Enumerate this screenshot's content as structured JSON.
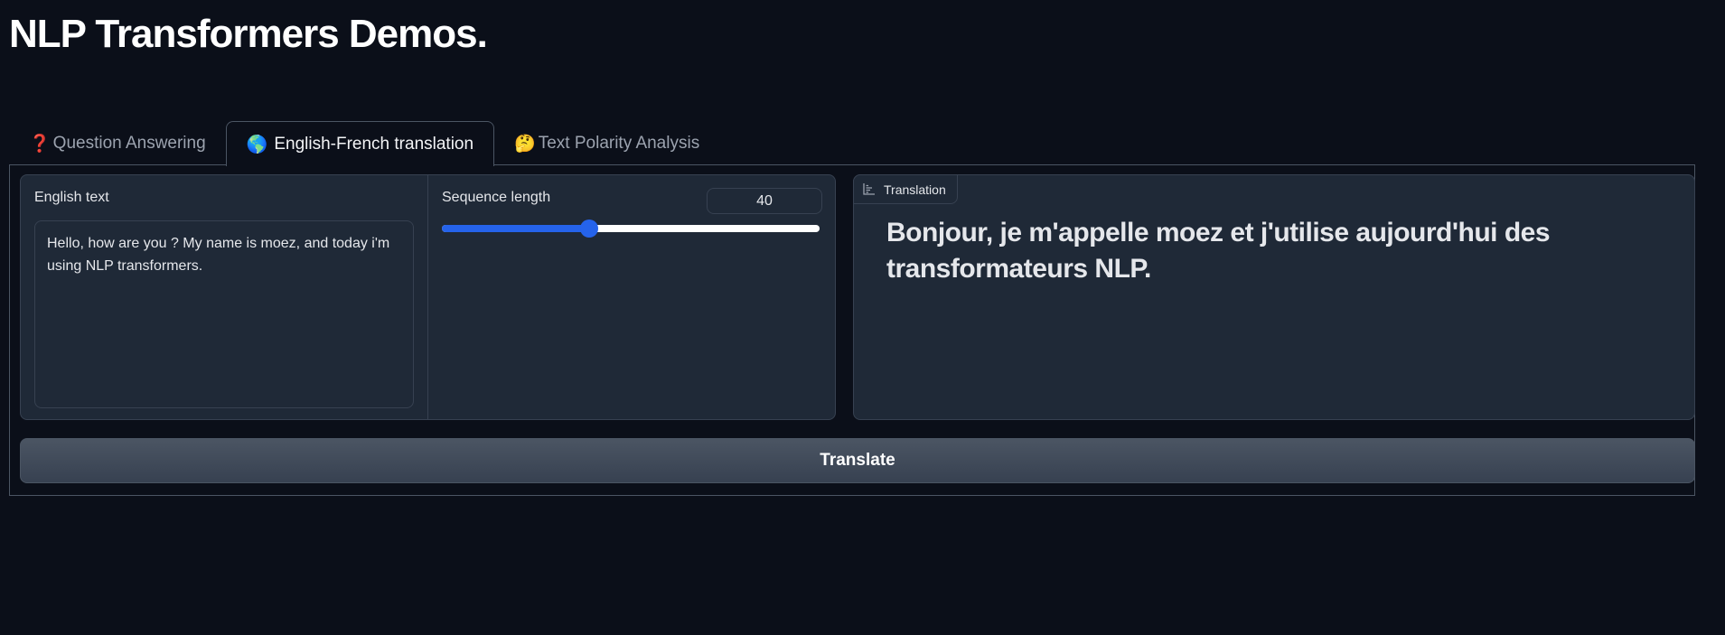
{
  "app": {
    "title": "NLP Transformers Demos."
  },
  "tabs": [
    {
      "emoji": "❓",
      "label": "Question Answering",
      "active": false
    },
    {
      "emoji": "🌎",
      "label": "English-French translation",
      "active": true
    },
    {
      "emoji": "🤔",
      "label": "Text Polarity Analysis",
      "active": false
    }
  ],
  "translation_tab": {
    "input": {
      "label": "English text",
      "value": "Hello, how are you ? My name is moez, and today i'm using NLP transformers."
    },
    "sequence_length": {
      "label": "Sequence length",
      "value": "40",
      "slider_fraction": 0.39
    },
    "output": {
      "label": "Translation",
      "icon": "chart-icon",
      "value": "Bonjour, je m'appelle moez et j'utilise aujourd'hui des transformateurs NLP."
    },
    "submit_label": "Translate"
  },
  "colors": {
    "background": "#0b0f19",
    "panel": "#1f2937",
    "border": "#374151",
    "accent": "#2563eb"
  }
}
